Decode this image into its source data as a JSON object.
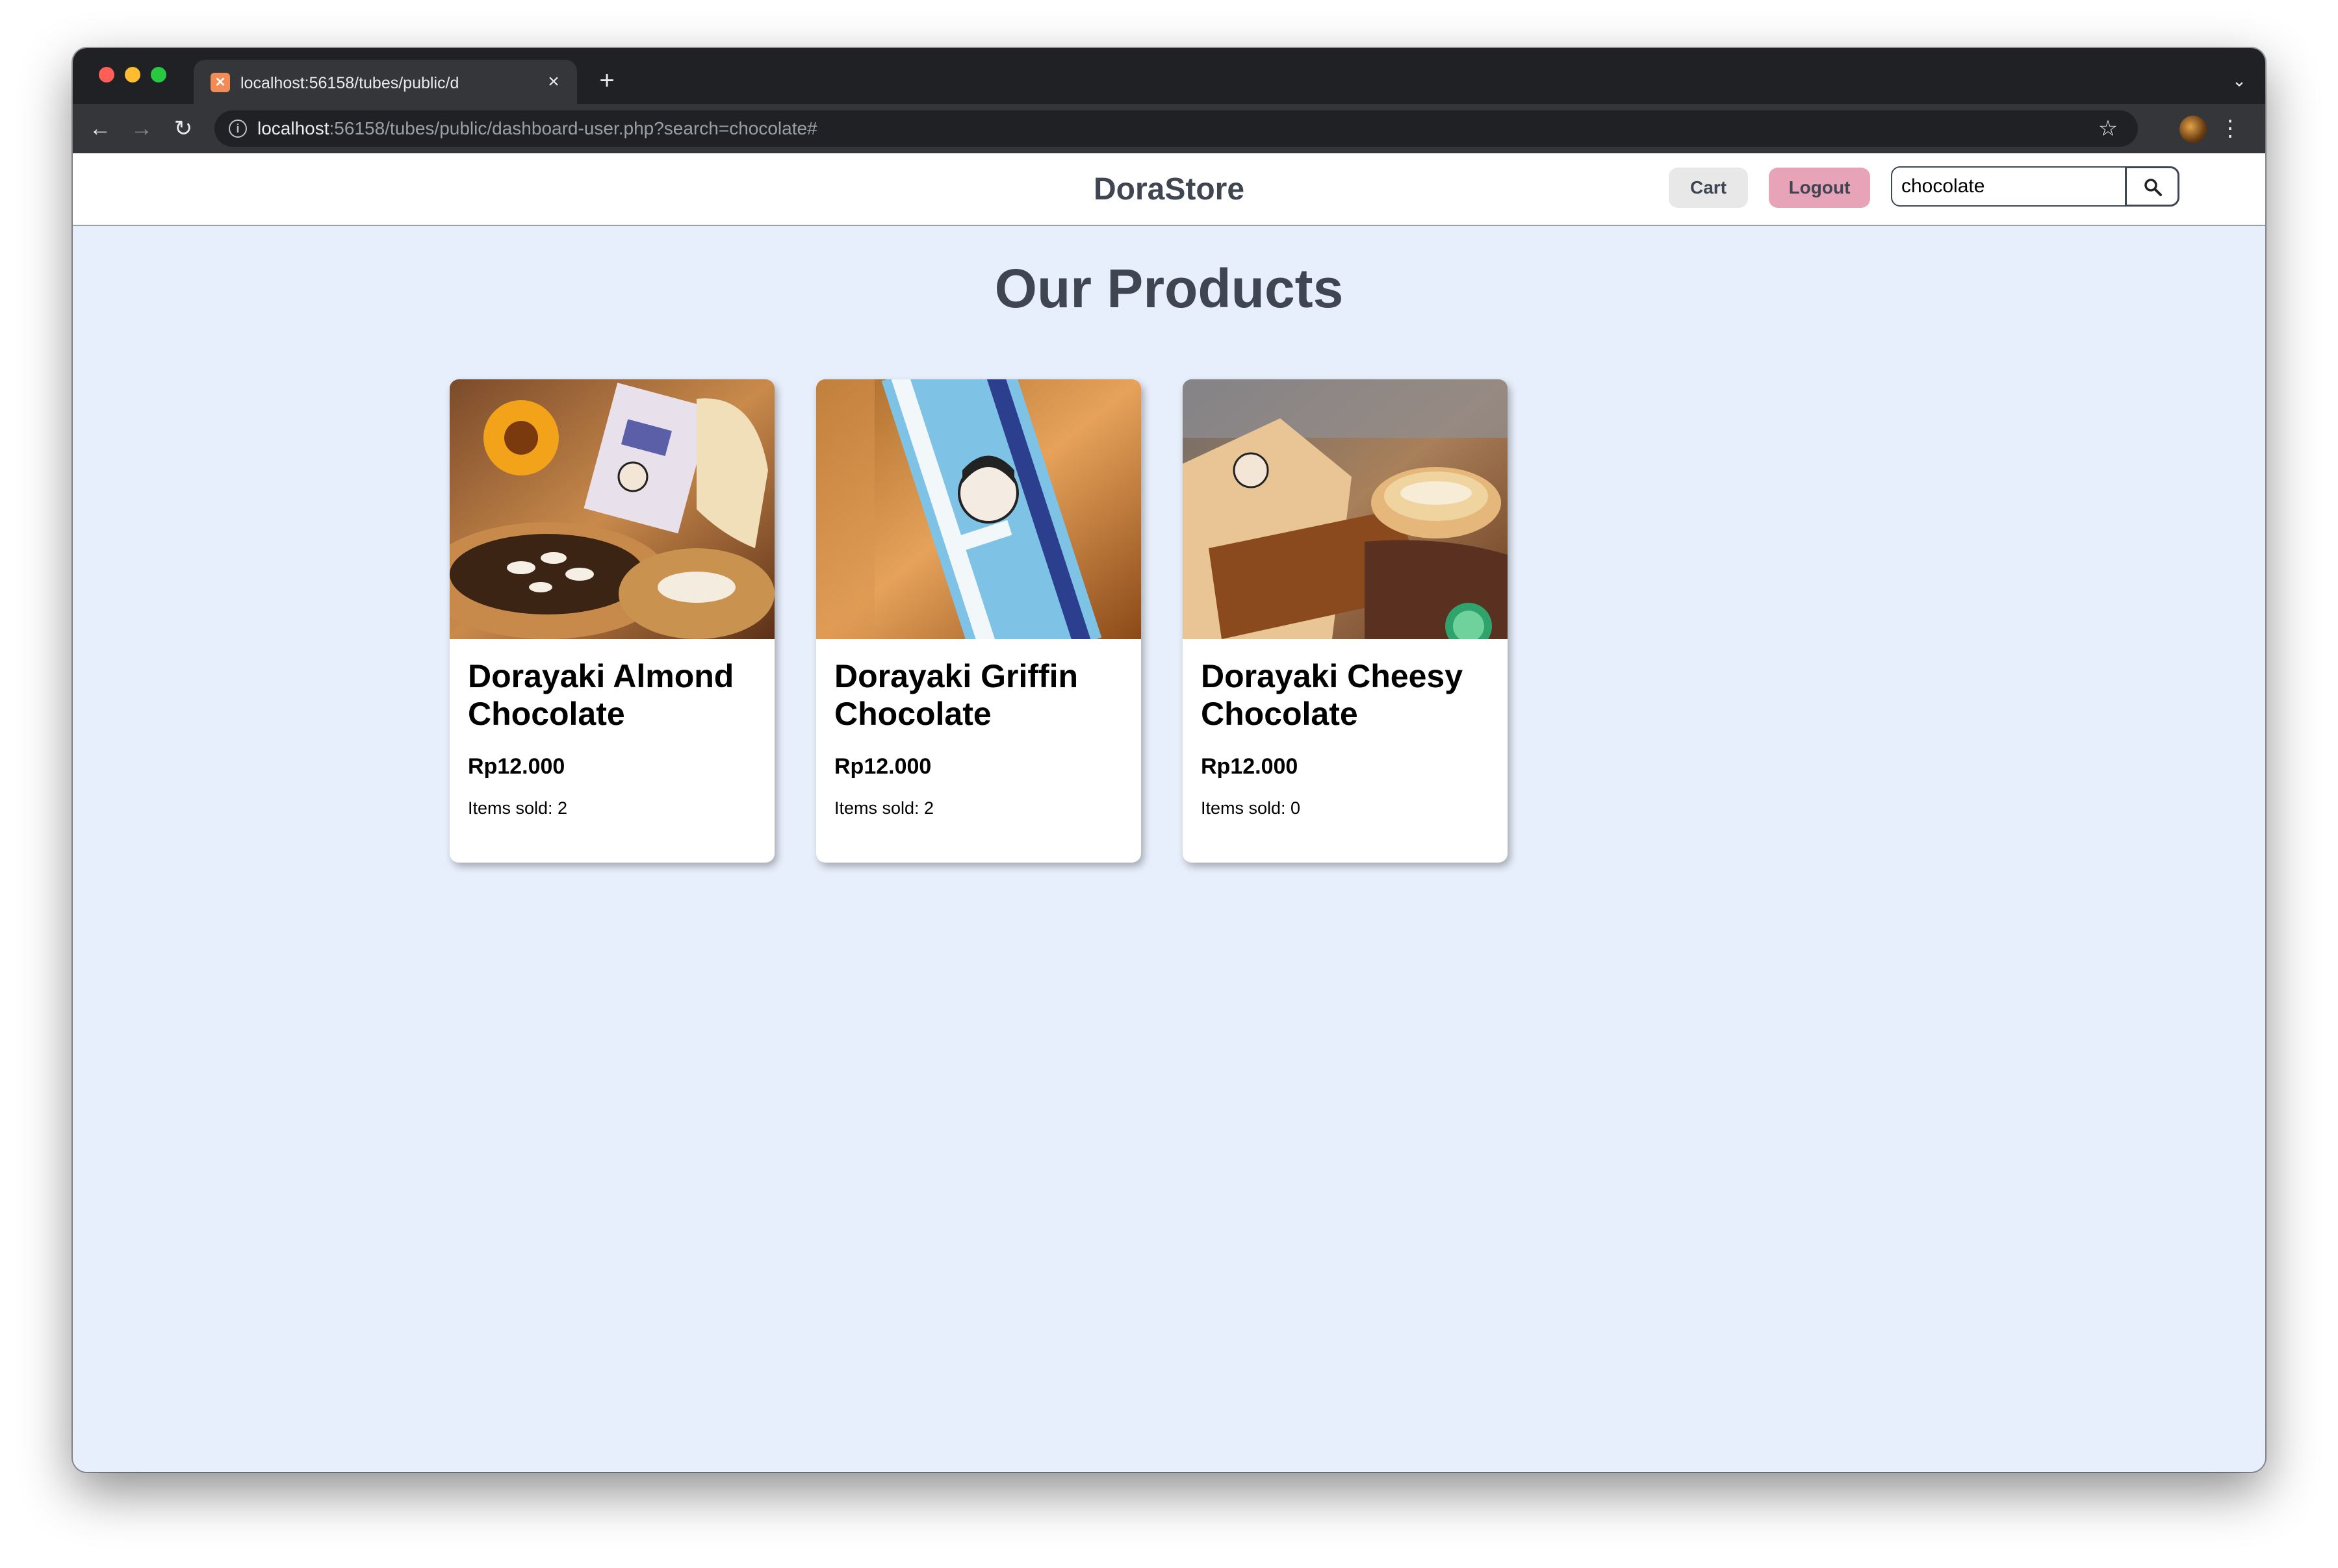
{
  "browser": {
    "tab_title": "localhost:56158/tubes/public/d",
    "url_host": "localhost",
    "url_rest": ":56158/tubes/public/dashboard-user.php?search=chocolate#",
    "icons": {
      "back": "back-arrow-icon",
      "forward": "forward-arrow-icon",
      "reload": "reload-icon",
      "info": "info-icon",
      "bookmark": "star-icon",
      "menu": "kebab-menu-icon",
      "tab_list": "chevron-down-icon",
      "new_tab": "plus-icon",
      "close_tab": "close-icon"
    }
  },
  "header": {
    "brand": "DoraStore",
    "cart_label": "Cart",
    "logout_label": "Logout",
    "search_value": "chocolate",
    "search_icon": "search-icon"
  },
  "main": {
    "title": "Our Products",
    "products": [
      {
        "name": "Dorayaki Almond Chocolate",
        "price": "Rp12.000",
        "sold": "Items sold: 2"
      },
      {
        "name": "Dorayaki Griffin Chocolate",
        "price": "Rp12.000",
        "sold": "Items sold: 2"
      },
      {
        "name": "Dorayaki Cheesy Chocolate",
        "price": "Rp12.000",
        "sold": "Items sold: 0"
      }
    ]
  },
  "colors": {
    "page_bg": "#e8effc",
    "text_dark": "#3f4651",
    "logout_bg": "#e7a3b8",
    "cart_bg": "#e8e8e8"
  }
}
